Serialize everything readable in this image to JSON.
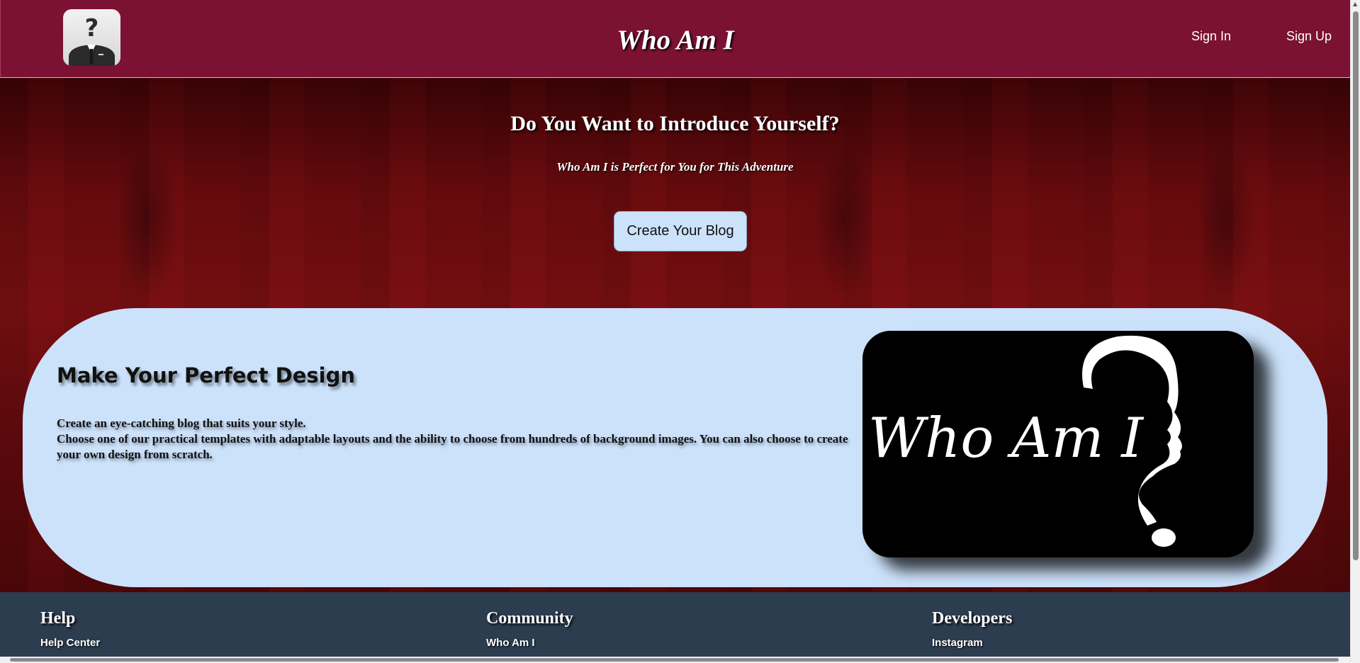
{
  "header": {
    "logo_icon": "anonymous-businessman-question-icon",
    "title": "Who Am I",
    "nav": {
      "sign_in": "Sign In",
      "sign_up": "Sign Up"
    }
  },
  "hero": {
    "title": "Do You Want to Introduce Yourself?",
    "subtitle": "Who Am I is Perfect for You for This Adventure",
    "cta_label": "Create Your Blog"
  },
  "feature": {
    "title": "Make Your Perfect Design",
    "line1": "Create an eye-catching blog that suits your style.",
    "line2": "Choose one of our practical templates with adaptable layouts and the ability to choose from hundreds of background images. You can also choose to create your own design from scratch.",
    "image_text": "Who Am I"
  },
  "footer": {
    "columns": [
      {
        "heading": "Help",
        "link": "Help Center"
      },
      {
        "heading": "Community",
        "link": "Who Am I"
      },
      {
        "heading": "Developers",
        "link": "Instagram"
      }
    ]
  },
  "colors": {
    "header_bg": "#7c1233",
    "panel_bg": "#cce2fb",
    "footer_bg": "#2c3d50"
  }
}
